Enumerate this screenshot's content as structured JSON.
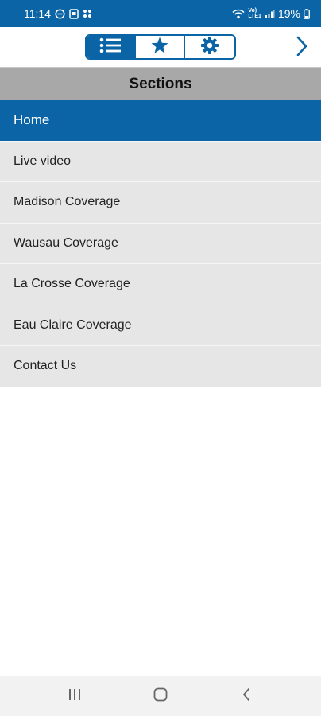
{
  "status_bar": {
    "time": "11:14",
    "battery": "19%",
    "network": "Vo)\nLTE1"
  },
  "toolbar": {
    "tabs": [
      {
        "icon": "list-icon",
        "active": true
      },
      {
        "icon": "star-icon",
        "active": false
      },
      {
        "icon": "gear-icon",
        "active": false
      }
    ],
    "next_icon": "chevron-right-icon"
  },
  "section_header": {
    "title": "Sections"
  },
  "sections": [
    {
      "label": "Home",
      "active": true
    },
    {
      "label": "Live video",
      "active": false
    },
    {
      "label": "Madison Coverage",
      "active": false
    },
    {
      "label": "Wausau Coverage",
      "active": false
    },
    {
      "label": "La Crosse Coverage",
      "active": false
    },
    {
      "label": "Eau Claire Coverage",
      "active": false
    },
    {
      "label": "Contact Us",
      "active": false
    }
  ],
  "nav_bar": {
    "buttons": [
      "recents-icon",
      "home-icon",
      "back-icon"
    ]
  },
  "colors": {
    "primary": "#0a64a6",
    "header_gray": "#a8a8a8",
    "list_bg": "#e6e6e6"
  }
}
